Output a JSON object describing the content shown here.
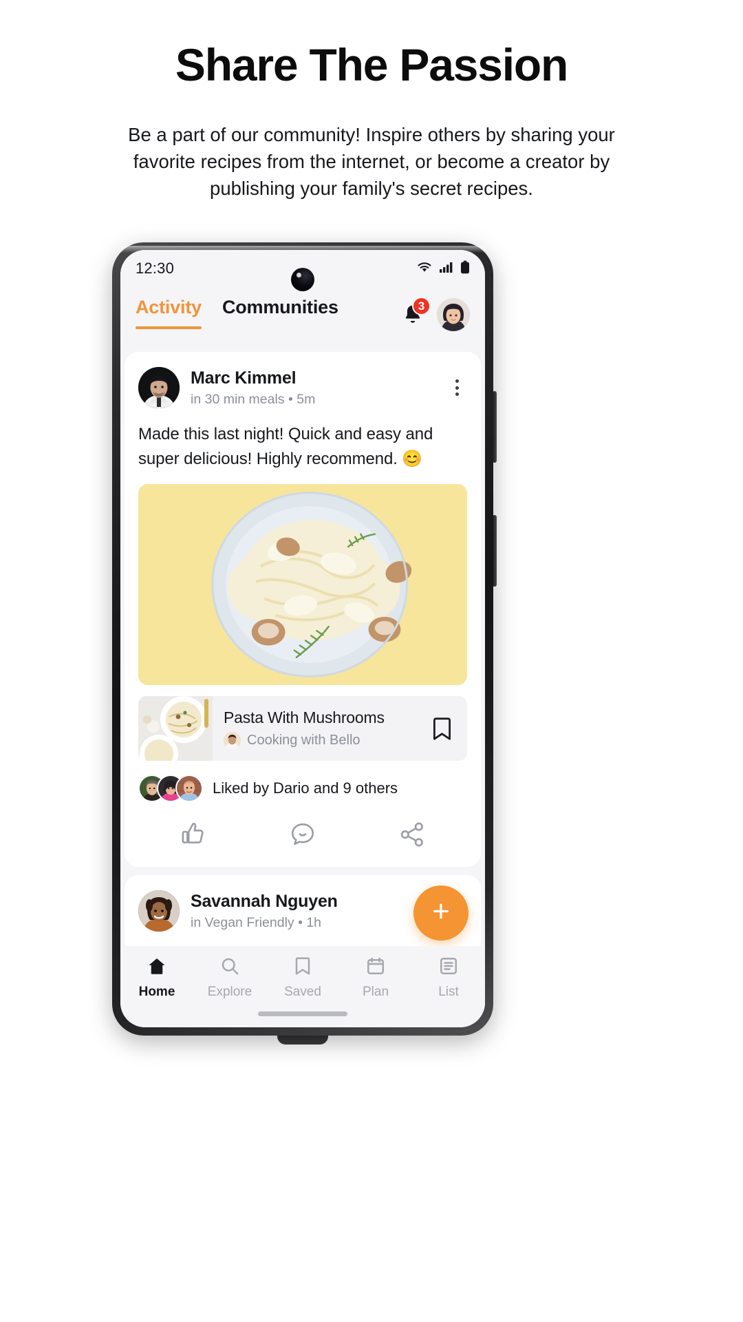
{
  "hero": {
    "title": "Share The Passion",
    "subtitle": "Be a part of our community! Inspire others by sharing your favorite recipes from the internet, or become a creator by publishing your family's secret recipes."
  },
  "phone": {
    "status_bar": {
      "time": "12:30",
      "wifi_icon": "wifi-icon",
      "signal_icon": "cellular-signal-icon",
      "battery_icon": "battery-icon"
    },
    "header": {
      "tabs": [
        {
          "label": "Activity",
          "active": true
        },
        {
          "label": "Communities",
          "active": false
        }
      ],
      "bell_icon": "notification-bell-icon",
      "notification_count": "3",
      "avatar_label": "user-avatar"
    },
    "posts": [
      {
        "author": "Marc Kimmel",
        "meta": "in 30 min meals • 5m",
        "text": "Made this last night! Quick and easy and super delicious! Highly recommend. 😊",
        "more_icon": "more-options-icon",
        "photo_alt": "creamy pasta with mushrooms on yellow background",
        "recipe": {
          "title": "Pasta With Mushrooms",
          "creator": "Cooking with Bello",
          "bookmark_icon": "bookmark-icon"
        },
        "likes_text": "Liked by Dario and 9 others",
        "actions": [
          {
            "icon": "thumbs-up-icon",
            "name": "like"
          },
          {
            "icon": "comment-bubble-icon",
            "name": "comment"
          },
          {
            "icon": "share-icon",
            "name": "share"
          }
        ]
      },
      {
        "author": "Savannah Nguyen",
        "meta": "in Vegan Friendly • 1h"
      }
    ],
    "fab": {
      "label": "+",
      "icon": "plus-icon"
    },
    "bottom_nav": [
      {
        "label": "Home",
        "icon": "home-icon",
        "active": true
      },
      {
        "label": "Explore",
        "icon": "search-icon",
        "active": false
      },
      {
        "label": "Saved",
        "icon": "bookmark-icon",
        "active": false
      },
      {
        "label": "Plan",
        "icon": "calendar-icon",
        "active": false
      },
      {
        "label": "List",
        "icon": "list-icon",
        "active": false
      }
    ]
  },
  "colors": {
    "accent_orange": "#f0943a",
    "fab_orange": "#f59432",
    "badge_red": "#ef3124",
    "photo_yellow": "#f7e59c",
    "text_primary": "#16181c",
    "text_muted": "#8b8f98",
    "screen_bg": "#f5f5f7"
  }
}
